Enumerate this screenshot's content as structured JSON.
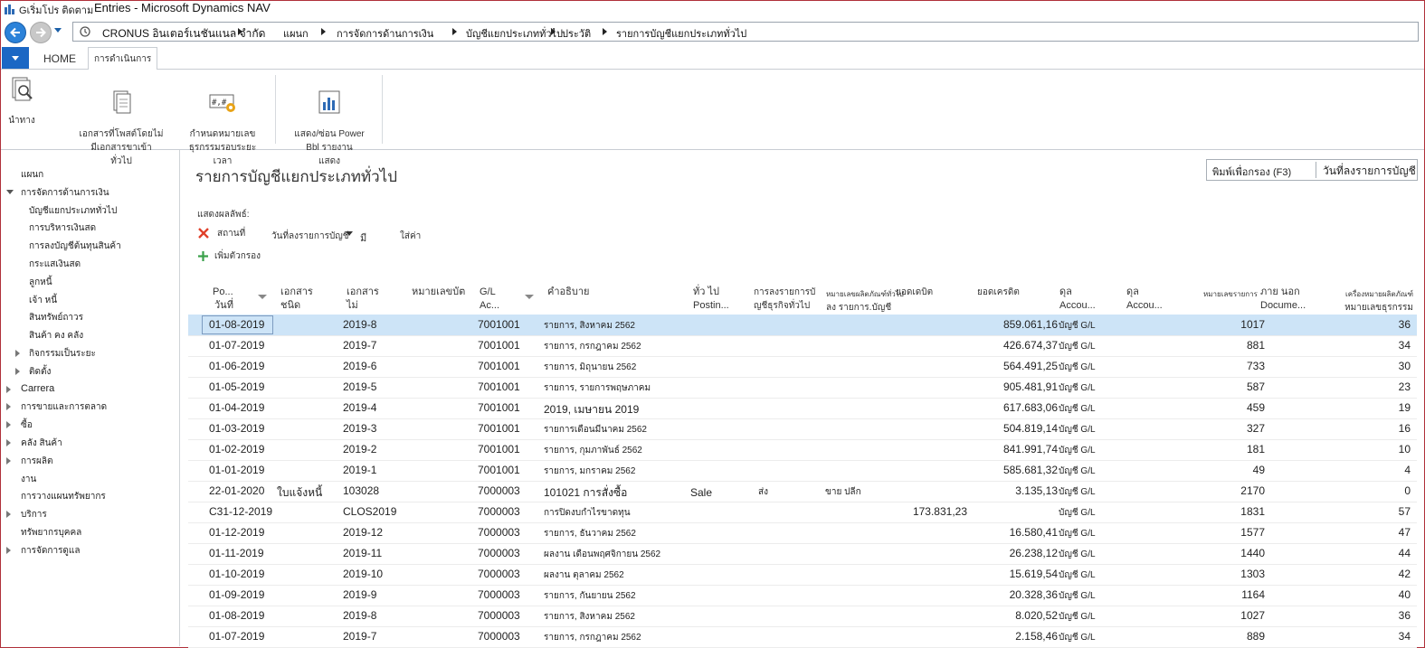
{
  "window": {
    "app_title": "Gเริ่มโปร ติดตาม",
    "title": "Entries - Microsoft Dynamics NAV"
  },
  "address": {
    "company": "CRONUS อินเตอร์เนชันแนล จำกัด",
    "crumbs": [
      "แผนก",
      "การจัดการด้านการเงิน",
      "บัญชีแยกประเภททั่วไป",
      "ประวัติ",
      "รายการบัญชีแยกประเภททั่วไป"
    ]
  },
  "ribbon": {
    "tabs": [
      "HOME",
      "การดำเนินการ"
    ],
    "buttons": [
      {
        "label": "นำทาง",
        "icon": "navigate-icon"
      },
      {
        "label": "เอกสารที่โพสต์โดยไม่\nมีเอกสารขาเข้า\nทั่วไป",
        "icon": "posted-documents-icon"
      },
      {
        "label": "กำหนดหมายเลข\nธุรกรรมรอบระยะเวลา",
        "icon": "set-transaction-number-icon"
      },
      {
        "label": "แสดง/ซ่อน Power\nBbl รายงาน\nแสดง",
        "icon": "power-bi-icon"
      }
    ]
  },
  "leftnav": {
    "items": [
      {
        "label": "แผนก",
        "level": 1,
        "expander": "none"
      },
      {
        "label": "การจัดการด้านการเงิน",
        "level": 1,
        "expander": "open"
      },
      {
        "label": "บัญชีแยกประเภททั่วไป",
        "level": 2,
        "expander": "none"
      },
      {
        "label": "การบริหารเงินสด",
        "level": 2,
        "expander": "none"
      },
      {
        "label": "การลงบัญชีต้นทุนสินค้า",
        "level": 2,
        "expander": "none"
      },
      {
        "label": "กระแสเงินสด",
        "level": 2,
        "expander": "none"
      },
      {
        "label": "ลูกหนี้",
        "level": 2,
        "expander": "none"
      },
      {
        "label": "เจ้า หนี้",
        "level": 2,
        "expander": "none"
      },
      {
        "label": "สินทรัพย์ถาวร",
        "level": 2,
        "expander": "none"
      },
      {
        "label": "สินค้า คง คลัง",
        "level": 2,
        "expander": "none"
      },
      {
        "label": "กิจกรรมเป็นระยะ",
        "level": 2,
        "expander": "closed"
      },
      {
        "label": "ติดตั้ง",
        "level": 2,
        "expander": "closed"
      },
      {
        "label": "Carrera",
        "level": 1,
        "expander": "closed"
      },
      {
        "label": "การขายและการตลาด",
        "level": 1,
        "expander": "closed"
      },
      {
        "label": "ซื้อ",
        "level": 1,
        "expander": "closed"
      },
      {
        "label": "คลัง สินค้า",
        "level": 1,
        "expander": "closed"
      },
      {
        "label": "การผลิต",
        "level": 1,
        "expander": "closed"
      },
      {
        "label": "งาน",
        "level": 1,
        "expander": "none"
      },
      {
        "label": "การวางแผนทรัพยากร",
        "level": 1,
        "expander": "none"
      },
      {
        "label": "บริการ",
        "level": 1,
        "expander": "closed"
      },
      {
        "label": "ทรัพยากรบุคคล",
        "level": 1,
        "expander": "none"
      },
      {
        "label": "การจัดการดูแล",
        "level": 1,
        "expander": "closed"
      }
    ]
  },
  "page": {
    "title": "รายการบัญชีแยกประเภททั่วไป",
    "search_placeholder": "พิมพ์เพื่อกรอง (F3)",
    "search_field": "วันที่ลงรายการบัญชี",
    "filter_heading": "แสดงผลลัพธ์:",
    "filter_where": "สถานที่",
    "filter_field": "วันที่ลงรายการบัญชี",
    "filter_op": "มี",
    "filter_value": "ใส่ค่า",
    "add_filter": "เพิ่มตัวกรอง"
  },
  "grid": {
    "headers": {
      "date": [
        "Po...",
        "วันที่"
      ],
      "doc_type": [
        "เอกสาร",
        "ชนิด"
      ],
      "doc_no": [
        "เอกสาร",
        "ไม่"
      ],
      "ext_doc": [
        "หมายเลขบัต"
      ],
      "account": [
        "G/L",
        "Ac..."
      ],
      "desc": [
        "คำอธิบาย"
      ],
      "gen_post": [
        "ทั่ว ไป",
        "Postin..."
      ],
      "gen_bus": [
        "การลงรายการบั",
        "ญชีธุรกิจทั่วไป"
      ],
      "gen_prod": [
        "หมายเลขผลิตภัณฑ์ทั่วไป",
        "ลง รายการ.บัญชี"
      ],
      "debit": [
        "ยอดเดบิต"
      ],
      "credit": [
        "ยอดเครดิต"
      ],
      "bal_type": [
        "ดุล",
        "Accou..."
      ],
      "bal_no": [
        "ดุล",
        "Accou..."
      ],
      "entry_no": [
        "หมายเลขรายการ"
      ],
      "ext_doc2": [
        "ภาย นอก",
        "Docume..."
      ],
      "trans_no": [
        "เครื่องหมายผลิตภัณฑ์",
        "หมายเลขธุรกรรม"
      ]
    },
    "rows": [
      {
        "date": "01-08-2019",
        "doc_type": "",
        "doc_no": "2019-8",
        "account": "7001001",
        "desc": "รายการ, สิงหาคม 2562",
        "gen_post": "",
        "gen_bus": "",
        "gen_prod": "",
        "debit": "",
        "credit": "859.061,16",
        "bal_type": "บัญชี G/L",
        "entry_no": "1017",
        "trans_no": "36"
      },
      {
        "date": "01-07-2019",
        "doc_type": "",
        "doc_no": "2019-7",
        "account": "7001001",
        "desc": "รายการ, กรกฎาคม 2562",
        "gen_post": "",
        "gen_bus": "",
        "gen_prod": "",
        "debit": "",
        "credit": "426.674,37",
        "bal_type": "บัญชี G/L",
        "entry_no": "881",
        "trans_no": "34"
      },
      {
        "date": "01-06-2019",
        "doc_type": "",
        "doc_no": "2019-6",
        "account": "7001001",
        "desc": "รายการ, มิถุนายน 2562",
        "gen_post": "",
        "gen_bus": "",
        "gen_prod": "",
        "debit": "",
        "credit": "564.491,25",
        "bal_type": "บัญชี G/L",
        "entry_no": "733",
        "trans_no": "30"
      },
      {
        "date": "01-05-2019",
        "doc_type": "",
        "doc_no": "2019-5",
        "account": "7001001",
        "desc": "รายการ, รายการพฤษภาคม",
        "gen_post": "",
        "gen_bus": "",
        "gen_prod": "",
        "debit": "",
        "credit": "905.481,91",
        "bal_type": "บัญชี G/L",
        "entry_no": "587",
        "trans_no": "23"
      },
      {
        "date": "01-04-2019",
        "doc_type": "",
        "doc_no": "2019-4",
        "account": "7001001",
        "desc": "2019, เมษายน 2019",
        "gen_post": "",
        "gen_bus": "",
        "gen_prod": "",
        "debit": "",
        "credit": "617.683,06",
        "bal_type": "บัญชี G/L",
        "entry_no": "459",
        "trans_no": "19"
      },
      {
        "date": "01-03-2019",
        "doc_type": "",
        "doc_no": "2019-3",
        "account": "7001001",
        "desc": "รายการเดือนมีนาคม 2562",
        "gen_post": "",
        "gen_bus": "",
        "gen_prod": "",
        "debit": "",
        "credit": "504.819,14",
        "bal_type": "บัญชี G/L",
        "entry_no": "327",
        "trans_no": "16"
      },
      {
        "date": "01-02-2019",
        "doc_type": "",
        "doc_no": "2019-2",
        "account": "7001001",
        "desc": "รายการ, กุมภาพันธ์ 2562",
        "gen_post": "",
        "gen_bus": "",
        "gen_prod": "",
        "debit": "",
        "credit": "841.991,74",
        "bal_type": "บัญชี G/L",
        "entry_no": "181",
        "trans_no": "10"
      },
      {
        "date": "01-01-2019",
        "doc_type": "",
        "doc_no": "2019-1",
        "account": "7001001",
        "desc": "รายการ, มกราคม 2562",
        "gen_post": "",
        "gen_bus": "",
        "gen_prod": "",
        "debit": "",
        "credit": "585.681,32",
        "bal_type": "บัญชี G/L",
        "entry_no": "49",
        "trans_no": "4"
      },
      {
        "date": "22-01-2020",
        "doc_type": "ใบแจ้งหนี้",
        "doc_no": "103028",
        "account": "7000003",
        "desc": "101021 การสั่งซื้อ",
        "gen_post": "Sale",
        "gen_bus": "ส่ง",
        "gen_prod": "ขาย ปลีก",
        "debit": "",
        "credit": "3.135,13",
        "bal_type": "บัญชี G/L",
        "entry_no": "2170",
        "trans_no": "0"
      },
      {
        "date": "C31-12-2019",
        "doc_type": "",
        "doc_no": "CLOS2019",
        "account": "7000003",
        "desc": "การปิดงบกำไรขาดทุน",
        "gen_post": "",
        "gen_bus": "",
        "gen_prod": "",
        "debit": "173.831,23",
        "credit": "",
        "bal_type": "บัญชี G/L",
        "entry_no": "1831",
        "trans_no": "57"
      },
      {
        "date": "01-12-2019",
        "doc_type": "",
        "doc_no": "2019-12",
        "account": "7000003",
        "desc": "รายการ, ธันวาคม 2562",
        "gen_post": "",
        "gen_bus": "",
        "gen_prod": "",
        "debit": "",
        "credit": "16.580,41",
        "bal_type": "บัญชี G/L",
        "entry_no": "1577",
        "trans_no": "47"
      },
      {
        "date": "01-11-2019",
        "doc_type": "",
        "doc_no": "2019-11",
        "account": "7000003",
        "desc": "ผลงาน เดือนพฤศจิกายน 2562",
        "gen_post": "",
        "gen_bus": "",
        "gen_prod": "",
        "debit": "",
        "credit": "26.238,12",
        "bal_type": "บัญชี G/L",
        "entry_no": "1440",
        "trans_no": "44"
      },
      {
        "date": "01-10-2019",
        "doc_type": "",
        "doc_no": "2019-10",
        "account": "7000003",
        "desc": "ผลงาน ตุลาคม 2562",
        "gen_post": "",
        "gen_bus": "",
        "gen_prod": "",
        "debit": "",
        "credit": "15.619,54",
        "bal_type": "บัญชี G/L",
        "entry_no": "1303",
        "trans_no": "42"
      },
      {
        "date": "01-09-2019",
        "doc_type": "",
        "doc_no": "2019-9",
        "account": "7000003",
        "desc": "รายการ, กันยายน 2562",
        "gen_post": "",
        "gen_bus": "",
        "gen_prod": "",
        "debit": "",
        "credit": "20.328,36",
        "bal_type": "บัญชี G/L",
        "entry_no": "1164",
        "trans_no": "40"
      },
      {
        "date": "01-08-2019",
        "doc_type": "",
        "doc_no": "2019-8",
        "account": "7000003",
        "desc": "รายการ, สิงหาคม 2562",
        "gen_post": "",
        "gen_bus": "",
        "gen_prod": "",
        "debit": "",
        "credit": "8.020,52",
        "bal_type": "บัญชี G/L",
        "entry_no": "1027",
        "trans_no": "36"
      },
      {
        "date": "01-07-2019",
        "doc_type": "",
        "doc_no": "2019-7",
        "account": "7000003",
        "desc": "รายการ, กรกฎาคม 2562",
        "gen_post": "",
        "gen_bus": "",
        "gen_prod": "",
        "debit": "",
        "credit": "2.158,46",
        "bal_type": "บัญชี G/L",
        "entry_no": "889",
        "trans_no": "34"
      }
    ]
  },
  "colors": {
    "accent": "#1b67c4",
    "selected_row": "#cde4f7",
    "frame": "#b0303a",
    "remove_filter": "#e0402a",
    "add_filter": "#3aa14a"
  }
}
